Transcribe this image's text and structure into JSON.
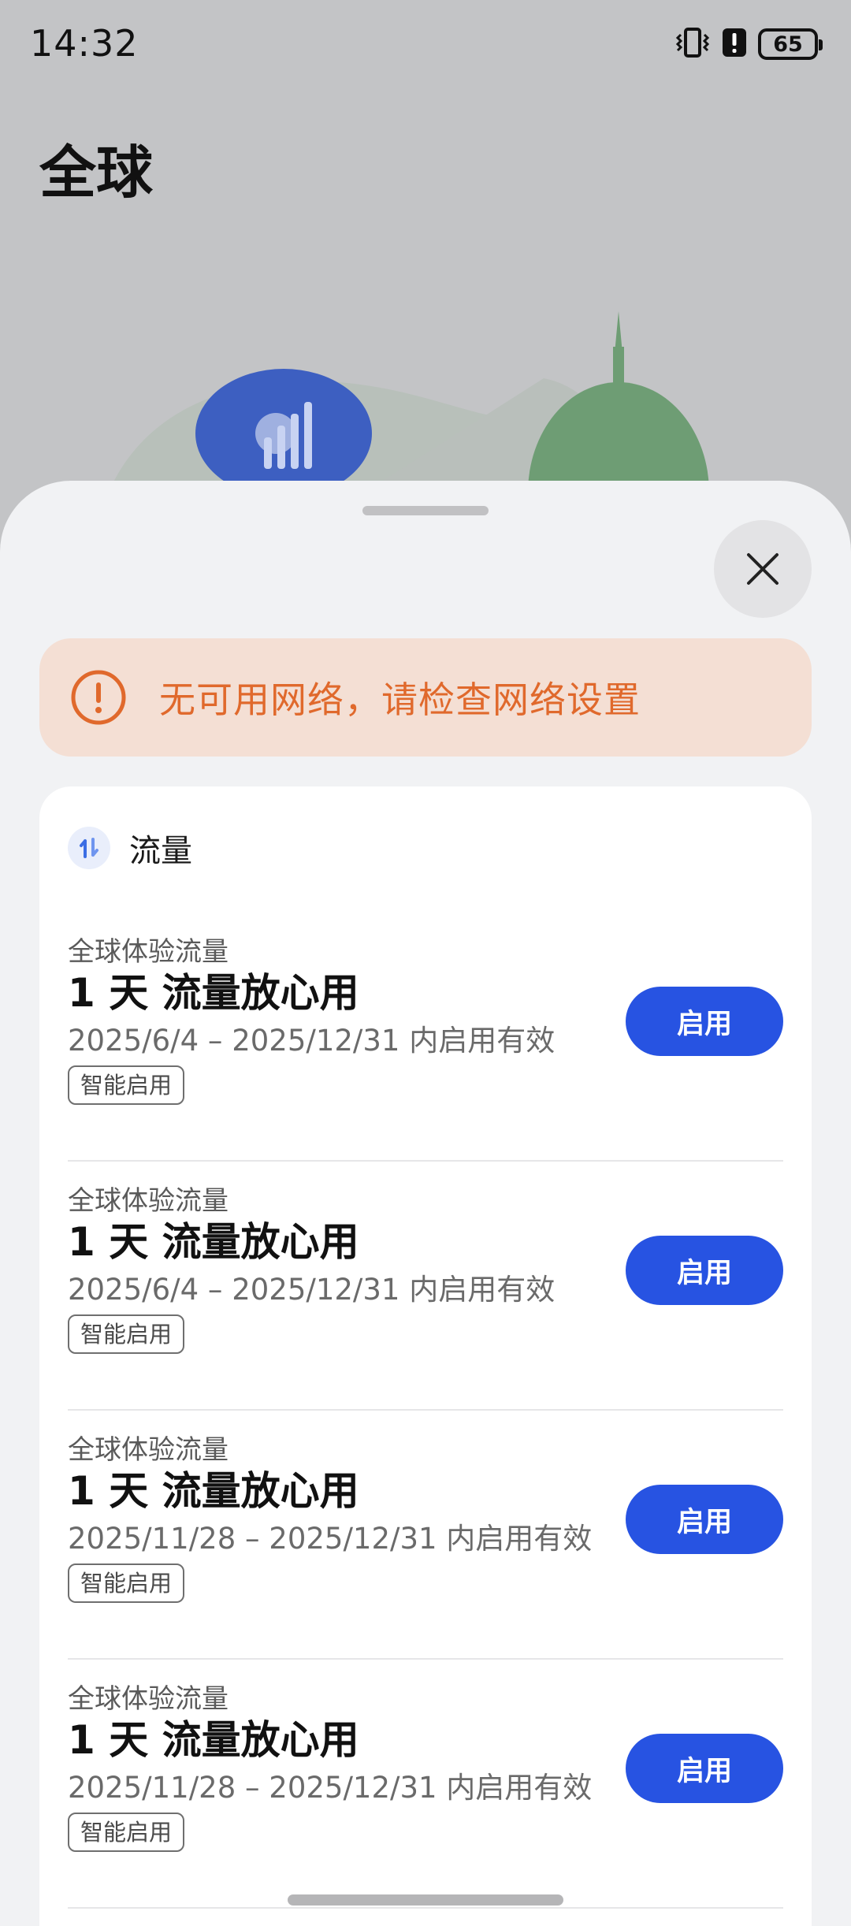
{
  "status_bar": {
    "time": "14:32",
    "battery": "65"
  },
  "page": {
    "title": "全球"
  },
  "alert": {
    "text": "无可用网络，请检查网络设置"
  },
  "data_card": {
    "title": "流量",
    "plans": [
      {
        "category": "全球体验流量",
        "name": "1 天 流量放心用",
        "validity": "2025/6/4 – 2025/12/31 内启用有效",
        "tag": "智能启用",
        "button": "启用"
      },
      {
        "category": "全球体验流量",
        "name": "1 天 流量放心用",
        "validity": "2025/6/4 – 2025/12/31 内启用有效",
        "tag": "智能启用",
        "button": "启用"
      },
      {
        "category": "全球体验流量",
        "name": "1 天 流量放心用",
        "validity": "2025/11/28 – 2025/12/31 内启用有效",
        "tag": "智能启用",
        "button": "启用"
      },
      {
        "category": "全球体验流量",
        "name": "1 天 流量放心用",
        "validity": "2025/11/28 – 2025/12/31 内启用有效",
        "tag": "智能启用",
        "button": "启用"
      }
    ]
  },
  "colors": {
    "accent": "#2753e2",
    "warning": "#e0692c",
    "warning_bg": "#f4dfd4"
  },
  "icons": [
    "vibrate-icon",
    "alert-icon",
    "battery-icon",
    "close-icon",
    "warning-icon",
    "data-transfer-icon",
    "globe-signal-icon"
  ]
}
